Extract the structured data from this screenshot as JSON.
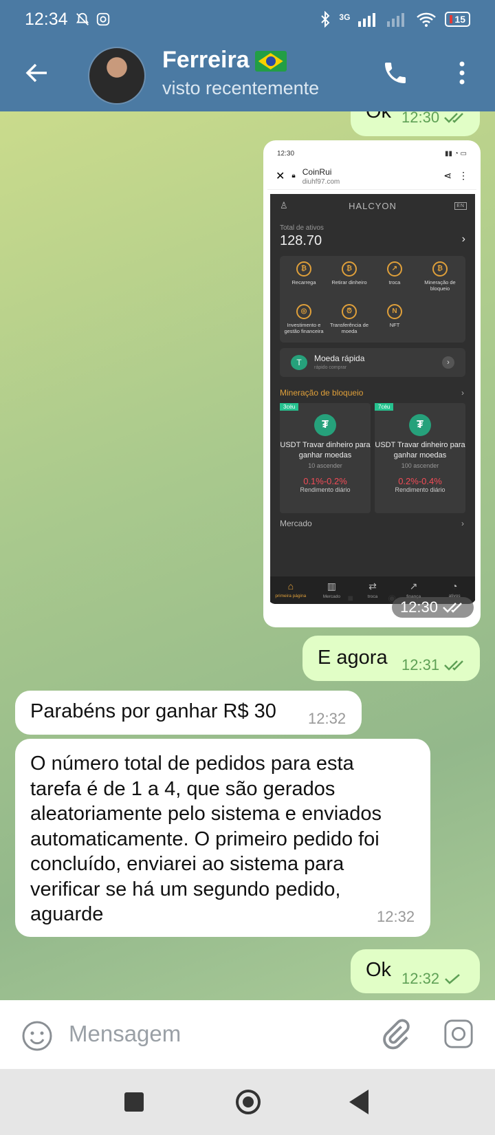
{
  "status_bar": {
    "time": "12:34",
    "network": "3G",
    "battery": "15"
  },
  "header": {
    "contact_name": "Ferreira",
    "flag": "brazil-flag",
    "status": "visto recentemente"
  },
  "messages": [
    {
      "type": "out",
      "text": "Ok",
      "time": "12:30",
      "read": true
    },
    {
      "type": "out_image",
      "time": "12:30",
      "read": true
    },
    {
      "type": "out",
      "text": "E agora",
      "time": "12:31",
      "read": true
    },
    {
      "type": "in",
      "text": "Parabéns por ganhar R$ 30",
      "time": "12:32"
    },
    {
      "type": "in",
      "text": "O número total de pedidos para esta tarefa é de 1 a 4, que são gerados aleatoriamente pelo sistema e enviados automaticamente. O primeiro pedido foi concluído, enviarei ao sistema para verificar se há um segundo pedido, aguarde",
      "time": "12:32"
    },
    {
      "type": "out",
      "text": "Ok",
      "time": "12:32",
      "read": false
    }
  ],
  "screenshot": {
    "time": "12:30",
    "site_name": "CoinRui",
    "site_url": "diuhf97.com",
    "app_title": "HALCYON",
    "lang": "EN",
    "total_label": "Total de ativos",
    "total_value": "128.70",
    "grid": [
      "Recarrega",
      "Retirar dinheiro",
      "troca",
      "Mineração de bloqueio",
      "Investimento e gestão financeira",
      "Transferência de moeda",
      "NFT"
    ],
    "quick_title": "Moeda rápida",
    "quick_sub": "rápido comprar",
    "section_mining": "Mineração de bloqueio",
    "cards": [
      {
        "tag": "3céu",
        "title": "USDT Travar dinheiro para ganhar moedas",
        "sub": "10 ascender",
        "pct": "0.1%-0.2%",
        "label": "Rendimento diário"
      },
      {
        "tag": "7céu",
        "title": "USDT Travar dinheiro para ganhar moedas",
        "sub": "100 ascender",
        "pct": "0.2%-0.4%",
        "label": "Rendimento diário"
      }
    ],
    "section_market": "Mercado",
    "nav": [
      "primeira página",
      "Mercado",
      "troca",
      "finança",
      "ativos"
    ]
  },
  "input": {
    "placeholder": "Mensagem"
  },
  "colors": {
    "header": "#4b7aa3",
    "outgoing": "#e1fec6",
    "incoming": "#ffffff",
    "check": "#5ea055"
  }
}
